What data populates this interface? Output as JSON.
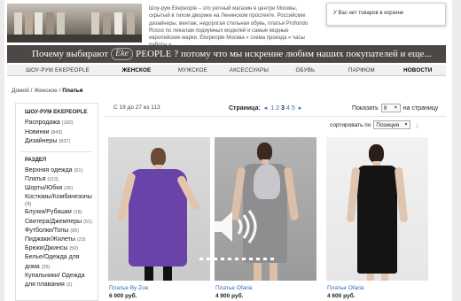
{
  "header": {
    "description": "Шоу-рум Ekepeople – это уютный магазин в центре Москвы, скрытый в тихом дворике на Ленинском проспекте. Российские дизайнеры, винтаж, недорогая стильная обувь, платья Profondo Rosso по лекалам подиумных моделей и самые модные европейские марки. Ekepeople Москва « схема проезда « часы работы »",
    "cart_text": "У Вас нет товаров в корзине"
  },
  "banner": {
    "pre": "Почему выбирают",
    "logo_script": "Eke",
    "logo_word": "PEOPLE ?",
    "post": "потому что мы искренне любим наших покупателей и еще..."
  },
  "nav": {
    "items": [
      {
        "label": "ШОУ-РУМ EKEPEOPLE"
      },
      {
        "label": "ЖЕНСКОЕ"
      },
      {
        "label": "МУЖСКОЕ"
      },
      {
        "label": "АКСЕССУАРЫ"
      },
      {
        "label": "ОБУВЬ"
      },
      {
        "label": "ПАРФЮМ"
      },
      {
        "label": "НОВОСТИ"
      }
    ]
  },
  "breadcrumb": {
    "home": "Домой",
    "sep1": " / ",
    "section": "Женское",
    "sep2": " / ",
    "current": "Платья"
  },
  "sidebar": {
    "title": "ШОУ-РУМ EKEPEOPLE",
    "links": [
      {
        "label": "Распродажа",
        "count": "(182)"
      },
      {
        "label": "Новинки",
        "count": "(843)"
      },
      {
        "label": "Дизайнеры",
        "count": "(837)"
      }
    ],
    "section_title": "РАЗДЕЛ",
    "categories": [
      {
        "label": "Верхняя одежда",
        "count": "(61)"
      },
      {
        "label": "Платья",
        "count": "(113)"
      },
      {
        "label": "Шорты/Юбки",
        "count": "(26)"
      },
      {
        "label": "Костюмы/Комбинезоны",
        "count": ""
      },
      {
        "label": "(4)",
        "count": "",
        "small": true
      },
      {
        "label": "Блузки/Рубашки",
        "count": "(18)"
      },
      {
        "label": "Свитера/Джемперы",
        "count": "(51)"
      },
      {
        "label": "Футболки/Топы",
        "count": "(95)"
      },
      {
        "label": "Пиджаки/Жилеты",
        "count": "(23)"
      },
      {
        "label": "Брюки/Джинсы",
        "count": "(50)"
      },
      {
        "label": "Белье/Одежда для",
        "count": ""
      },
      {
        "label": "дома",
        "count": "(25)"
      },
      {
        "label": "Купальники/ Одежда",
        "count": ""
      },
      {
        "label": "для плавания",
        "count": "(2)"
      }
    ]
  },
  "toolbar": {
    "range": "С 19 до 27 из 113",
    "pager_label": "Страница:",
    "pager_prev": "◂",
    "pages": [
      "1",
      "2",
      "3",
      "4",
      "5"
    ],
    "current_page": "3",
    "pager_next": "▸",
    "show_label": "Показать",
    "show_value": "9",
    "per_page_label": "на страницу",
    "sort_label": "сортировать по",
    "sort_value": "Позиция",
    "sort_dir_icon": "↓"
  },
  "products": [
    {
      "name": "Платье By Zoe",
      "price": "6 000 руб."
    },
    {
      "name": "Платье Ofaria",
      "price": "4 900 руб."
    },
    {
      "name": "Платье Ofaria",
      "price": "4 600 руб."
    }
  ],
  "video": {
    "icon": "speaker-volume-icon",
    "progress_segments": 11
  },
  "colors": {
    "link": "#3367c0",
    "banner_bg": "#4b4846",
    "sort_arrow": "#e07a1a",
    "dress1": "#6a43a8",
    "dress3": "#141414"
  }
}
